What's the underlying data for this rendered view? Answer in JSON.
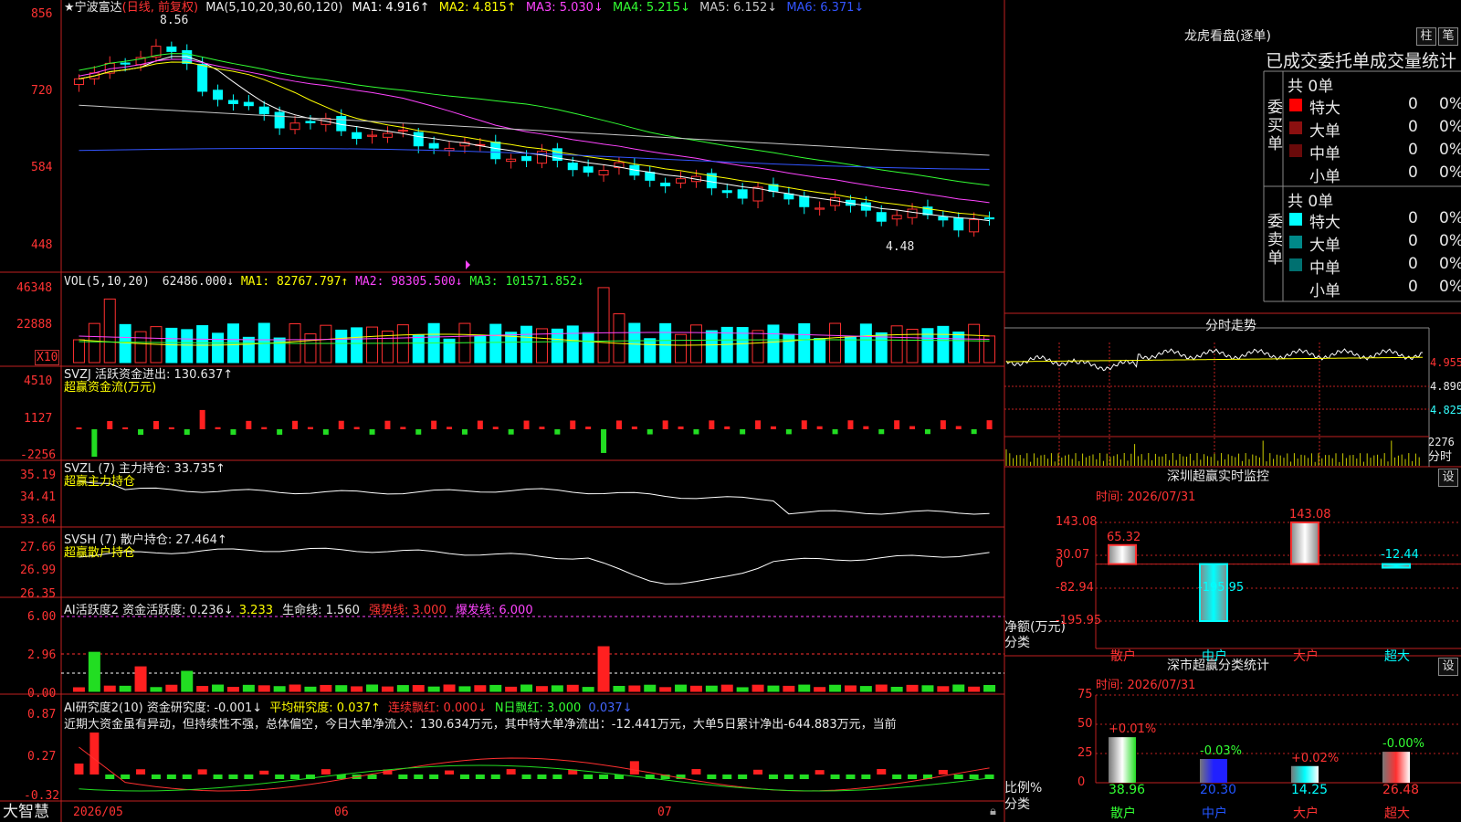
{
  "stock": {
    "title": "★宁波富达",
    "period": "(日线, 前复权)",
    "ma_label": "MA(5,10,20,30,60,120)",
    "ma": [
      {
        "label": "MA1: 4.916↑",
        "color": "#ffffff"
      },
      {
        "label": "MA2: 4.815↑",
        "color": "#ffff00"
      },
      {
        "label": "MA3: 5.030↓",
        "color": "#ff44ff"
      },
      {
        "label": "MA4: 5.215↓",
        "color": "#33ff33"
      },
      {
        "label": "MA5: 6.152↓",
        "color": "#c8c8c8"
      },
      {
        "label": "MA6: 6.371↓",
        "color": "#3355ff"
      }
    ],
    "price_axis": [
      "856",
      "720",
      "584",
      "448"
    ],
    "high_mark": "8.56",
    "low_mark": "4.48"
  },
  "vol": {
    "label": "VOL(5,10,20)",
    "value": "62486.000↓",
    "ma1": "MA1: 82767.797↑",
    "ma2": "MA2: 98305.500↓",
    "ma3": "MA3: 101571.852↓",
    "axis": [
      "46348",
      "22888"
    ],
    "unit": "X10"
  },
  "svzj": {
    "label": "SVZJ  活跃资金进出: 130.637↑",
    "sub": "超赢资金流(万元)",
    "axis": [
      "4510",
      "1127",
      "-2256"
    ]
  },
  "svzl": {
    "label": "SVZL (7) 主力持仓: 33.735↑",
    "sub": "超赢主力持仓",
    "axis": [
      "35.19",
      "34.41",
      "33.64"
    ]
  },
  "svsh": {
    "label": "SVSH (7) 散户持仓: 27.464↑",
    "sub": "超赢散户持仓",
    "axis": [
      "27.66",
      "26.99",
      "26.35"
    ]
  },
  "ai_active": {
    "label": "AI活跃度2 资金活跃度: 0.236↓",
    "v2": "3.233",
    "life": "生命线: 1.560",
    "strong": "强势线: 3.000",
    "burst": "爆发线: 6.000",
    "axis": [
      "6.00",
      "2.96",
      "0.00"
    ]
  },
  "ai_research": {
    "label": "AI研究度2(10) 资金研究度: -0.001↓",
    "avg": "平均研究度: 0.037↑",
    "lianxu": "连续飘红: 0.000↓",
    "nri": "N日飘红: 3.000",
    "last": "0.037↓",
    "comment": "近期大资金虽有异动，但持续性不强，总体偏空，今日大单净流入：130.634万元，其中特大单净流出：-12.441万元，大单5日累计净出-644.883万元，当前",
    "axis": [
      "0.87",
      "0.27",
      "-0.32"
    ]
  },
  "bottom": {
    "brand": "大智慧",
    "dates": [
      "2026/05",
      "06",
      "07"
    ]
  },
  "right": {
    "lhb_title": "龙虎看盘(逐单)",
    "btn_zhu": "柱",
    "btn_bi": "笔",
    "stat_title": "已成交委托单成交量统计",
    "buy_label": "委买单",
    "sell_label": "委卖单",
    "buy_total": "共 0单",
    "sell_total": "共 0单",
    "buy_rows": [
      {
        "name": "特大",
        "count": "0",
        "pct": "0%",
        "color": "#ff0000"
      },
      {
        "name": "大单",
        "count": "0",
        "pct": "0%",
        "color": "#8b1010"
      },
      {
        "name": "中单",
        "count": "0",
        "pct": "0%",
        "color": "#6a0a0a"
      },
      {
        "name": "小单",
        "count": "0",
        "pct": "0%",
        "color": ""
      }
    ],
    "sell_rows": [
      {
        "name": "特大",
        "count": "0",
        "pct": "0%",
        "color": "#00ffff"
      },
      {
        "name": "大单",
        "count": "0",
        "pct": "0%",
        "color": "#008888"
      },
      {
        "name": "中单",
        "count": "0",
        "pct": "0%",
        "color": "#007070"
      },
      {
        "name": "小单",
        "count": "0",
        "pct": "0%",
        "color": ""
      }
    ],
    "fenshi_title": "分时走势",
    "fenshi_axis": [
      "4.955",
      "4.890",
      "4.825"
    ],
    "fenshi_vol": "2276",
    "fenshi_unit": "分时",
    "sz_title": "深圳超赢实时监控",
    "sz_btn": "设",
    "sz_time": "时间: 2026/07/31",
    "sz_axis": [
      "143.08",
      "30.07",
      "0",
      "-82.94",
      "-195.95"
    ],
    "sz_ylabel": "净额(万元)",
    "sz_xlabel": "分类",
    "sz_values": [
      "65.32",
      "-195.95",
      "143.08",
      "-12.44"
    ],
    "sz_cats": [
      "散户",
      "中户",
      "大户",
      "超大"
    ],
    "sm_title": "深市超赢分类统计",
    "sm_btn": "设",
    "sm_time": "时间: 2026/07/31",
    "sm_axis": [
      "75",
      "50",
      "25",
      "0"
    ],
    "sm_ylabel": "比例%",
    "sm_xlabel": "分类",
    "sm_changes": [
      "+0.01%",
      "-0.03%",
      "+0.02%",
      "-0.00%"
    ],
    "sm_values": [
      "38.96",
      "20.30",
      "14.25",
      "26.48"
    ],
    "sm_cats": [
      "散户",
      "中户",
      "大户",
      "超大"
    ]
  },
  "chart_data": [
    {
      "type": "bar",
      "title": "深圳超赢实时监控",
      "ylabel": "净额(万元)",
      "xlabel": "分类",
      "categories": [
        "散户",
        "中户",
        "大户",
        "超大"
      ],
      "values": [
        65.32,
        -195.95,
        143.08,
        -12.44
      ],
      "ylim": [
        -195.95,
        143.08
      ]
    },
    {
      "type": "bar",
      "title": "深市超赢分类统计",
      "ylabel": "比例%",
      "xlabel": "分类",
      "categories": [
        "散户",
        "中户",
        "大户",
        "超大"
      ],
      "values": [
        38.96,
        20.3,
        14.25,
        26.48
      ],
      "ylim": [
        0,
        75
      ]
    }
  ]
}
